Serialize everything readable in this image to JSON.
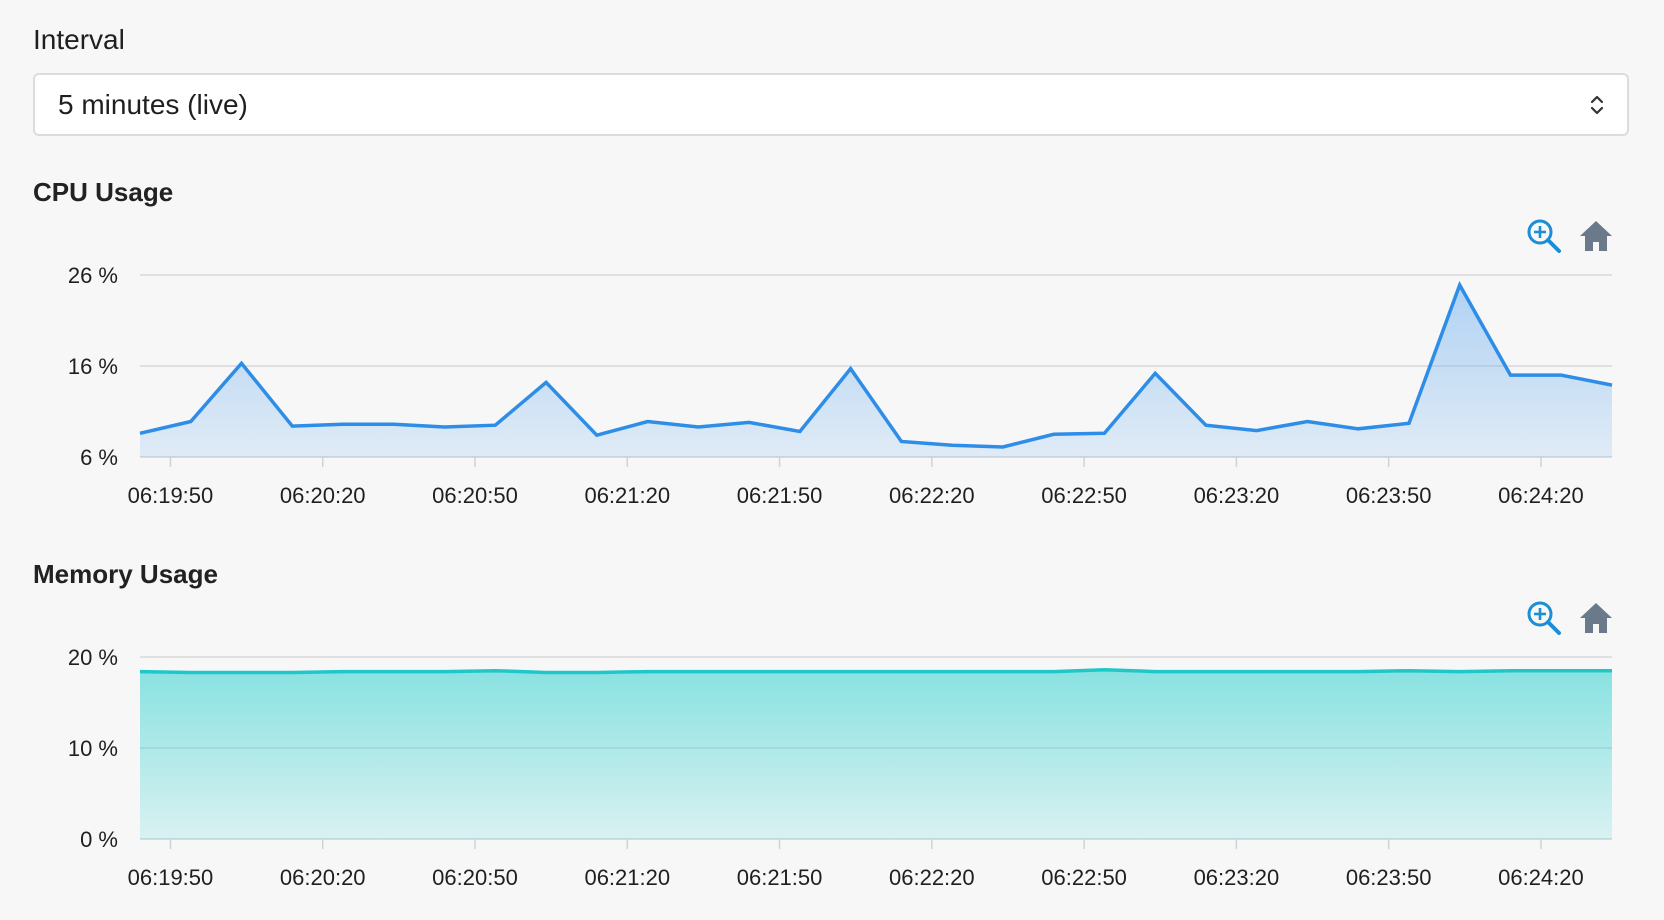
{
  "interval": {
    "label": "Interval",
    "selected": "5 minutes (live)"
  },
  "icons": {
    "zoom": "zoom-in-icon",
    "reset": "home-icon",
    "select": "chevron-up-down-icon"
  },
  "colors": {
    "cpu_line": "#2e8de6",
    "cpu_fill": "#cfe3fa",
    "memory_line": "#1fc8c8",
    "memory_fill": "#8ae4e4",
    "zoom_icon": "#1b8ed6",
    "home_icon": "#6b7a8a"
  },
  "chart_data": [
    {
      "type": "area",
      "title": "CPU Usage",
      "x": [
        "06:19:44",
        "06:19:54",
        "06:20:04",
        "06:20:14",
        "06:20:24",
        "06:20:34",
        "06:20:44",
        "06:20:54",
        "06:21:04",
        "06:21:14",
        "06:21:24",
        "06:21:34",
        "06:21:44",
        "06:21:54",
        "06:22:04",
        "06:22:14",
        "06:22:24",
        "06:22:34",
        "06:22:44",
        "06:22:54",
        "06:23:04",
        "06:23:14",
        "06:23:24",
        "06:23:34",
        "06:23:44",
        "06:23:54",
        "06:24:04",
        "06:24:14",
        "06:24:24",
        "06:24:34"
      ],
      "series": [
        {
          "values": [
            8.6,
            9.9,
            16.3,
            9.4,
            9.6,
            9.6,
            9.3,
            9.5,
            14.2,
            8.4,
            9.9,
            9.3,
            9.8,
            8.8,
            15.7,
            7.7,
            7.3,
            7.1,
            8.5,
            8.6,
            15.2,
            9.5,
            8.9,
            9.9,
            9.1,
            9.7,
            24.9,
            15.0,
            15.0,
            13.9
          ]
        }
      ],
      "yticks": [
        6,
        16,
        26
      ],
      "ytick_labels": [
        "6 %",
        "16 %",
        "26 %"
      ],
      "ylim": [
        6,
        26
      ],
      "xticks": [
        "06:19:50",
        "06:20:20",
        "06:20:50",
        "06:21:20",
        "06:21:50",
        "06:22:20",
        "06:22:50",
        "06:23:20",
        "06:23:50",
        "06:24:20"
      ],
      "grid": true
    },
    {
      "type": "area",
      "title": "Memory Usage",
      "x": [
        "06:19:44",
        "06:19:54",
        "06:20:04",
        "06:20:14",
        "06:20:24",
        "06:20:34",
        "06:20:44",
        "06:20:54",
        "06:21:04",
        "06:21:14",
        "06:21:24",
        "06:21:34",
        "06:21:44",
        "06:21:54",
        "06:22:04",
        "06:22:14",
        "06:22:24",
        "06:22:34",
        "06:22:44",
        "06:22:54",
        "06:23:04",
        "06:23:14",
        "06:23:24",
        "06:23:34",
        "06:23:44",
        "06:23:54",
        "06:24:04",
        "06:24:14",
        "06:24:24",
        "06:24:34"
      ],
      "series": [
        {
          "values": [
            18.4,
            18.3,
            18.3,
            18.3,
            18.4,
            18.4,
            18.4,
            18.5,
            18.3,
            18.3,
            18.4,
            18.4,
            18.4,
            18.4,
            18.4,
            18.4,
            18.4,
            18.4,
            18.4,
            18.6,
            18.4,
            18.4,
            18.4,
            18.4,
            18.4,
            18.5,
            18.4,
            18.5,
            18.5,
            18.5
          ]
        }
      ],
      "yticks": [
        0,
        10,
        20
      ],
      "ytick_labels": [
        "0 %",
        "10 %",
        "20 %"
      ],
      "ylim": [
        0,
        20
      ],
      "xticks": [
        "06:19:50",
        "06:20:20",
        "06:20:50",
        "06:21:20",
        "06:21:50",
        "06:22:20",
        "06:22:50",
        "06:23:20",
        "06:23:50",
        "06:24:20"
      ],
      "grid": true
    }
  ]
}
